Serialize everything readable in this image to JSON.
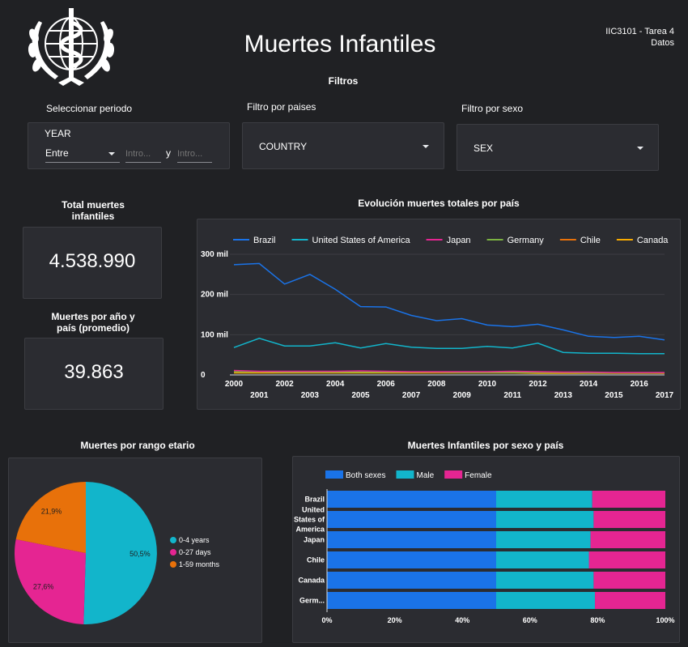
{
  "header": {
    "title": "Muertes Infantiles",
    "course": "IIC3101 - Tarea 4",
    "course_sub": "Datos",
    "filters_heading": "Filtros"
  },
  "filters": {
    "period_label": "Seleccionar periodo",
    "period_field": "YEAR",
    "period_operator": "Entre",
    "from_placeholder": "Intro...",
    "and_label": "y",
    "to_placeholder": "Intro...",
    "country_label": "Filtro por paises",
    "country_value": "COUNTRY",
    "sex_label": "Filtro por sexo",
    "sex_value": "SEX"
  },
  "kpis": {
    "total_label": "Total muertes infantiles",
    "total_value": "4.538.990",
    "avg_label": "Muertes por año y país (promedio)",
    "avg_value": "39.863"
  },
  "colors": {
    "brazil": "#1a73e8",
    "usa": "#12b5cb",
    "japan": "#e52592",
    "germany": "#7cb342",
    "chile": "#e8710a",
    "canada": "#f9ab00",
    "male": "#12b5cb",
    "female": "#e52592",
    "both": "#1a73e8"
  },
  "chart_data": [
    {
      "type": "line",
      "title": "Evolución muertes totales por país",
      "x": [
        2000,
        2001,
        2002,
        2003,
        2004,
        2005,
        2006,
        2007,
        2008,
        2009,
        2010,
        2011,
        2012,
        2013,
        2014,
        2015,
        2016,
        2017
      ],
      "x_tick_labels": [
        "2000",
        "2001",
        "2002",
        "2003",
        "2004",
        "2005",
        "2006",
        "2007",
        "2008",
        "2009",
        "2010",
        "2011",
        "2012",
        "2013",
        "2014",
        "2015",
        "2016",
        "2017"
      ],
      "y_tick_labels": [
        "300 mil",
        "200 mil",
        "100 mil",
        "0"
      ],
      "y_ticks": [
        300000,
        200000,
        100000,
        0
      ],
      "ylim": [
        0,
        300000
      ],
      "legend_position": "top",
      "grid": true,
      "series": [
        {
          "name": "Brazil",
          "color": "#1a73e8",
          "values": [
            274000,
            277000,
            226000,
            250000,
            213000,
            170000,
            169000,
            148000,
            135000,
            140000,
            124000,
            120000,
            126000,
            112000,
            96000,
            93000,
            96000,
            87000
          ]
        },
        {
          "name": "United States of America",
          "color": "#12b5cb",
          "values": [
            68000,
            91000,
            72000,
            72000,
            80000,
            67000,
            78000,
            69000,
            66000,
            66000,
            71000,
            67000,
            79000,
            56000,
            54000,
            54000,
            53000,
            53000
          ]
        },
        {
          "name": "Japan",
          "color": "#e52592",
          "values": [
            11000,
            9000,
            9000,
            9000,
            9000,
            10000,
            9000,
            8000,
            8000,
            8000,
            8000,
            9000,
            8000,
            7000,
            7000,
            6000,
            6000,
            6000
          ]
        },
        {
          "name": "Germany",
          "color": "#7cb342",
          "values": [
            8000,
            8000,
            7000,
            7000,
            7000,
            7000,
            7000,
            7000,
            7000,
            6000,
            6000,
            6000,
            6000,
            6000,
            5000,
            5000,
            5000,
            5000
          ]
        },
        {
          "name": "Chile",
          "color": "#e8710a",
          "values": [
            9000,
            8000,
            8000,
            7000,
            7000,
            8000,
            7000,
            7000,
            6000,
            6000,
            6000,
            7000,
            6000,
            6000,
            5000,
            5000,
            5000,
            4000
          ]
        },
        {
          "name": "Canada",
          "color": "#f9ab00",
          "values": [
            5000,
            5000,
            5000,
            5000,
            5000,
            5000,
            5000,
            5000,
            5000,
            5000,
            5000,
            5000,
            4000,
            4000,
            4000,
            4000,
            4000,
            4000
          ]
        }
      ]
    },
    {
      "type": "pie",
      "title": "Muertes por rango etario",
      "legend_position": "right",
      "slices": [
        {
          "name": "0-4 years",
          "value": 50.5,
          "label": "50,5%",
          "color": "#12b5cb"
        },
        {
          "name": "0-27 days",
          "value": 27.6,
          "label": "27,6%",
          "color": "#e52592"
        },
        {
          "name": "1-59 months",
          "value": 21.9,
          "label": "21,9%",
          "color": "#e8710a"
        }
      ]
    },
    {
      "type": "bar",
      "orientation": "horizontal",
      "stacked": "percent",
      "title": "Muertes Infantiles por sexo y país",
      "legend_position": "top",
      "categories": [
        "Brazil",
        "United States of America",
        "Japan",
        "Chile",
        "Canada",
        "Germ..."
      ],
      "category_lines": [
        [
          "Brazil"
        ],
        [
          "United",
          "States of",
          "America"
        ],
        [
          "Japan"
        ],
        [
          "Chile"
        ],
        [
          "Canada"
        ],
        [
          "Germ..."
        ]
      ],
      "x_tick_labels": [
        "0%",
        "20%",
        "40%",
        "60%",
        "80%",
        "100%"
      ],
      "xlim": [
        0,
        100
      ],
      "series": [
        {
          "name": "Both sexes",
          "color": "#1a73e8",
          "values": [
            50,
            50,
            50,
            50,
            50,
            50
          ]
        },
        {
          "name": "Male",
          "color": "#12b5cb",
          "values": [
            28.4,
            28.8,
            27.9,
            27.4,
            28.8,
            29.2
          ]
        },
        {
          "name": "Female",
          "color": "#e52592",
          "values": [
            21.6,
            21.2,
            22.1,
            22.6,
            21.2,
            20.8
          ]
        }
      ]
    }
  ]
}
